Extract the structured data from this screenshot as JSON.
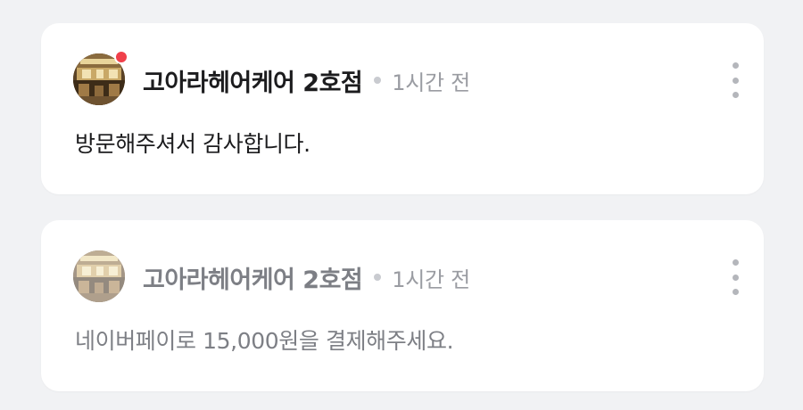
{
  "notifications": [
    {
      "shop_name": "고아라헤어케어 2호점",
      "time": "1시간 전",
      "message": "방문해주셔서 감사합니다.",
      "unread": true,
      "avatar_icon": "salon-interior-photo"
    },
    {
      "shop_name": "고아라헤어케어 2호점",
      "time": "1시간 전",
      "message": "네이버페이로 15,000원을 결제해주세요.",
      "unread": false,
      "avatar_icon": "salon-interior-photo"
    }
  ],
  "colors": {
    "background": "#f1f2f4",
    "card": "#ffffff",
    "unread_dot": "#f0404a",
    "text_primary": "#1c1c1e",
    "text_muted": "#7d7f85"
  }
}
